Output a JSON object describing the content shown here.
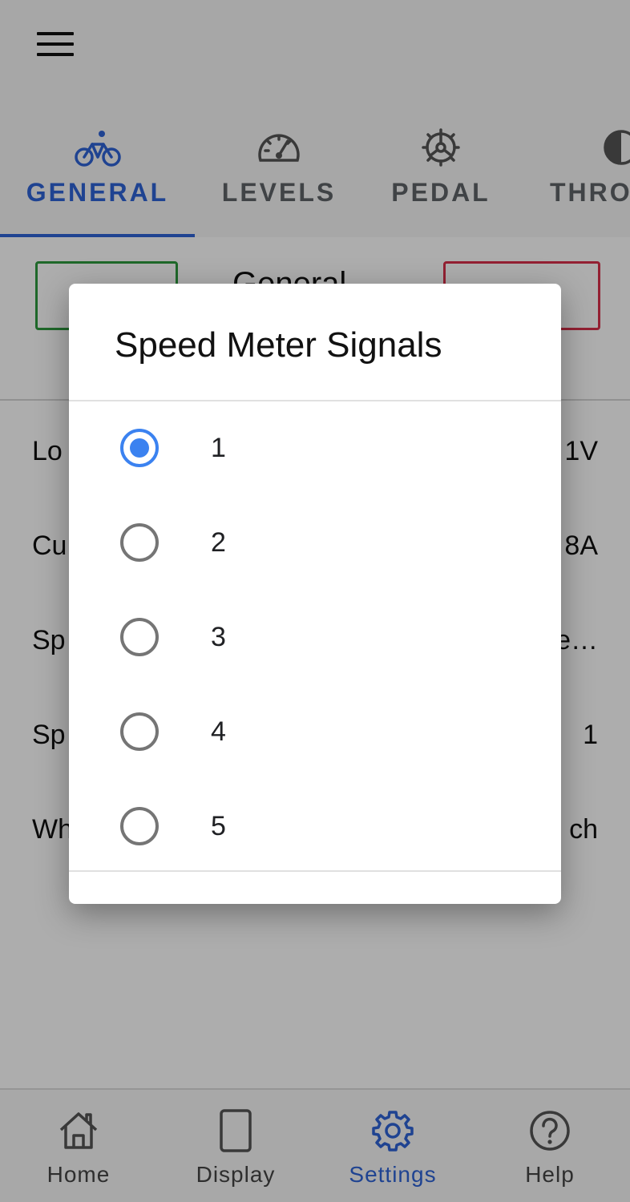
{
  "app_bar": {
    "menu_icon": "hamburger-menu-icon"
  },
  "tabs": [
    {
      "label": "GENERAL",
      "icon": "bicycle-icon",
      "active": true
    },
    {
      "label": "LEVELS",
      "icon": "speedometer-icon",
      "active": false
    },
    {
      "label": "PEDAL",
      "icon": "gear-wheel-icon",
      "active": false
    },
    {
      "label": "THRO",
      "icon": "throttle-icon",
      "active": false
    }
  ],
  "content": {
    "title": "General",
    "rows": [
      {
        "label": "Lo",
        "value": "1V"
      },
      {
        "label": "Cu",
        "value": "8A"
      },
      {
        "label": "Sp",
        "value": "e…"
      },
      {
        "label": "Sp",
        "value": "1"
      },
      {
        "label": "Wh",
        "value": "ch"
      }
    ]
  },
  "dialog": {
    "title": "Speed Meter Signals",
    "selected": "1",
    "options": [
      "1",
      "2",
      "3",
      "4",
      "5"
    ]
  },
  "bottom_nav": [
    {
      "label": "Home",
      "icon": "home-icon",
      "active": false
    },
    {
      "label": "Display",
      "icon": "display-icon",
      "active": false
    },
    {
      "label": "Settings",
      "icon": "settings-icon",
      "active": true
    },
    {
      "label": "Help",
      "icon": "help-icon",
      "active": false
    }
  ],
  "colors": {
    "accent": "#2f63d6",
    "radio_selected": "#3b82f0",
    "green_button": "#2e9a3f",
    "red_button": "#d9304a"
  }
}
